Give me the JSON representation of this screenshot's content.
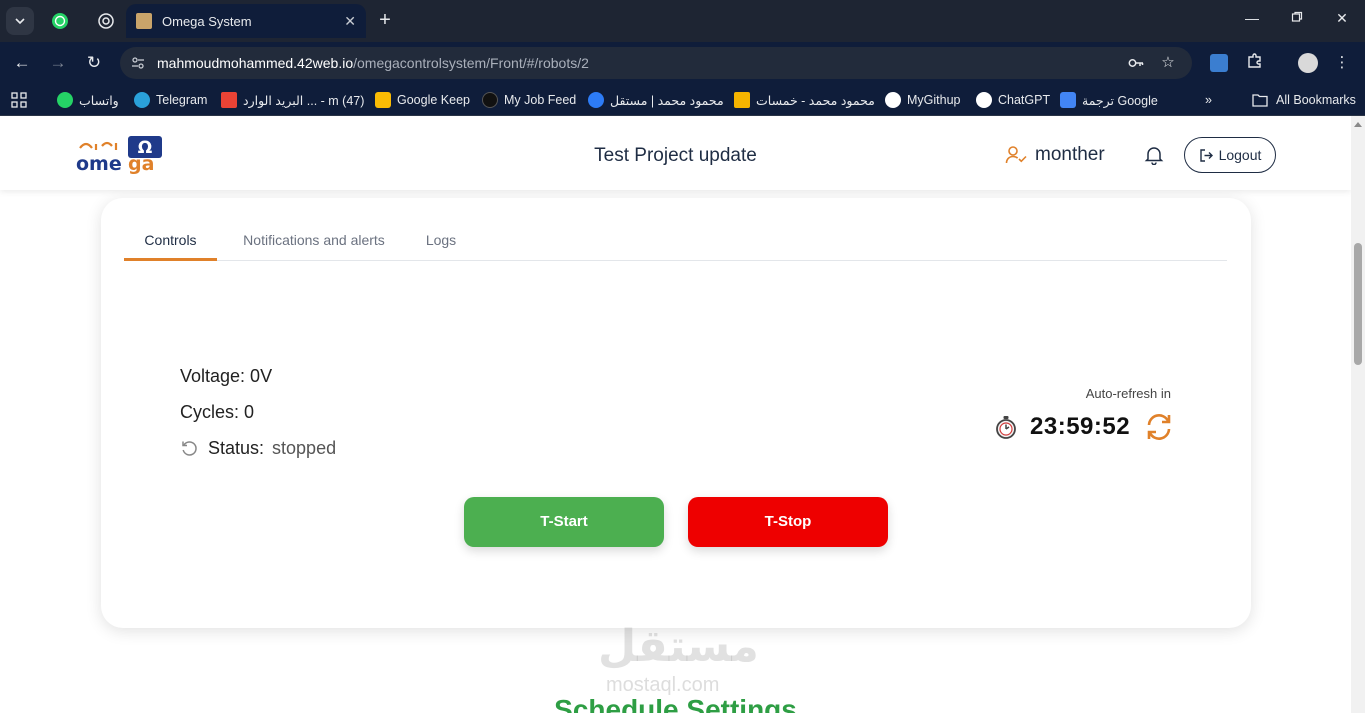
{
  "browser": {
    "tab_title": "Omega System",
    "url_host": "mahmoudmohammed.42web.io",
    "url_path": "/omegacontrolsystem/Front/#/robots/2",
    "bookmarks": [
      {
        "label": "واتساب",
        "icon": "whatsapp-icon",
        "color": "#25d366"
      },
      {
        "label": "Telegram",
        "icon": "telegram-icon",
        "color": "#2aa1da"
      },
      {
        "label": "البريد الوارد ... - m (47)",
        "icon": "gmail-icon",
        "color": "#ea4335"
      },
      {
        "label": "Google Keep",
        "icon": "keep-icon",
        "color": "#fbbc04"
      },
      {
        "label": "My Job Feed",
        "icon": "upwork-icon",
        "color": "#111111"
      },
      {
        "label": "محمود محمد | مستقل",
        "icon": "mostaql-icon",
        "color": "#2d7cf6"
      },
      {
        "label": "محمود محمد - خمسات",
        "icon": "khamsat-icon",
        "color": "#f5b400"
      },
      {
        "label": "MyGithup",
        "icon": "github-icon",
        "color": "#ffffff"
      },
      {
        "label": "ChatGPT",
        "icon": "chatgpt-icon",
        "color": "#ffffff"
      },
      {
        "label": "ترجمة Google",
        "icon": "translate-icon",
        "color": "#4285f4"
      }
    ],
    "all_bookmarks": "All Bookmarks"
  },
  "header": {
    "project_title": "Test Project update",
    "user_name": "monther",
    "logout_label": "Logout"
  },
  "tabs": [
    {
      "label": "Controls",
      "active": true
    },
    {
      "label": "Notifications and alerts",
      "active": false
    },
    {
      "label": "Logs",
      "active": false
    }
  ],
  "controls": {
    "voltage_label": "Voltage: 0V",
    "cycles_label": "Cycles: 0",
    "status_label": "Status:",
    "status_value": "stopped",
    "autorefresh_label": "Auto-refresh in",
    "timer": "23:59:52",
    "start_label": "T-Start",
    "stop_label": "T-Stop"
  },
  "section_title": "Schedule Settings",
  "watermark": "مستقل",
  "watermark_url": "mostaql.com",
  "colors": {
    "accent": "#e0812a",
    "start": "#4caf50",
    "stop": "#ee0000",
    "section": "#2e9e44"
  }
}
